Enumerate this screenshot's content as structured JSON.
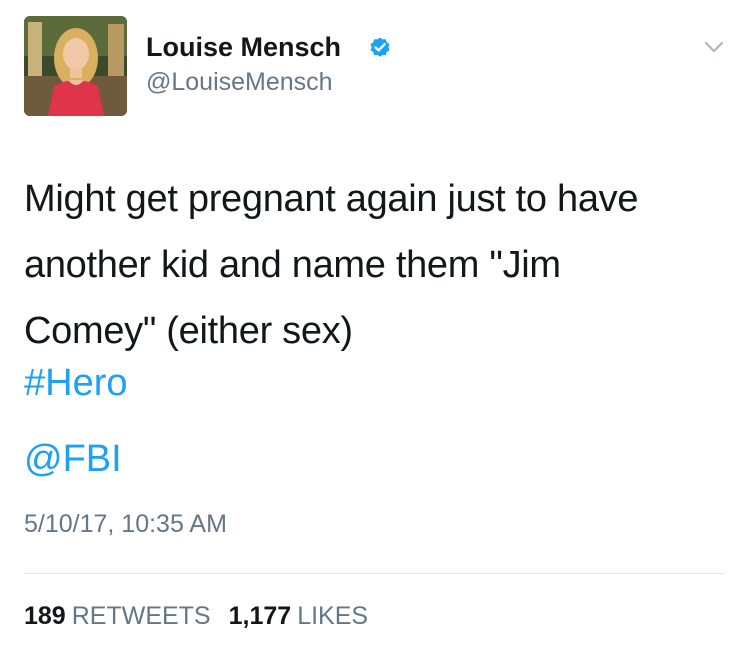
{
  "user": {
    "display_name": "Louise Mensch",
    "handle": "@LouiseMensch",
    "verified_icon": "verified-badge-icon",
    "colors": {
      "verified": "#1da1f2"
    }
  },
  "menu_icon": "chevron-down-icon",
  "tweet": {
    "text_lines": [
      "Might get pregnant again just to have",
      "another kid and name them \"Jim",
      "Comey\" (either sex)"
    ],
    "hashtag": "#Hero",
    "mention": "@FBI",
    "timestamp": "5/10/17, 10:35 AM"
  },
  "stats": {
    "retweets_count": "189",
    "retweets_label": "RETWEETS",
    "likes_count": "1,177",
    "likes_label": "LIKES"
  },
  "colors": {
    "text": "#14171a",
    "secondary": "#657786",
    "link": "#1da1f2",
    "divider": "#e1e8ed"
  }
}
